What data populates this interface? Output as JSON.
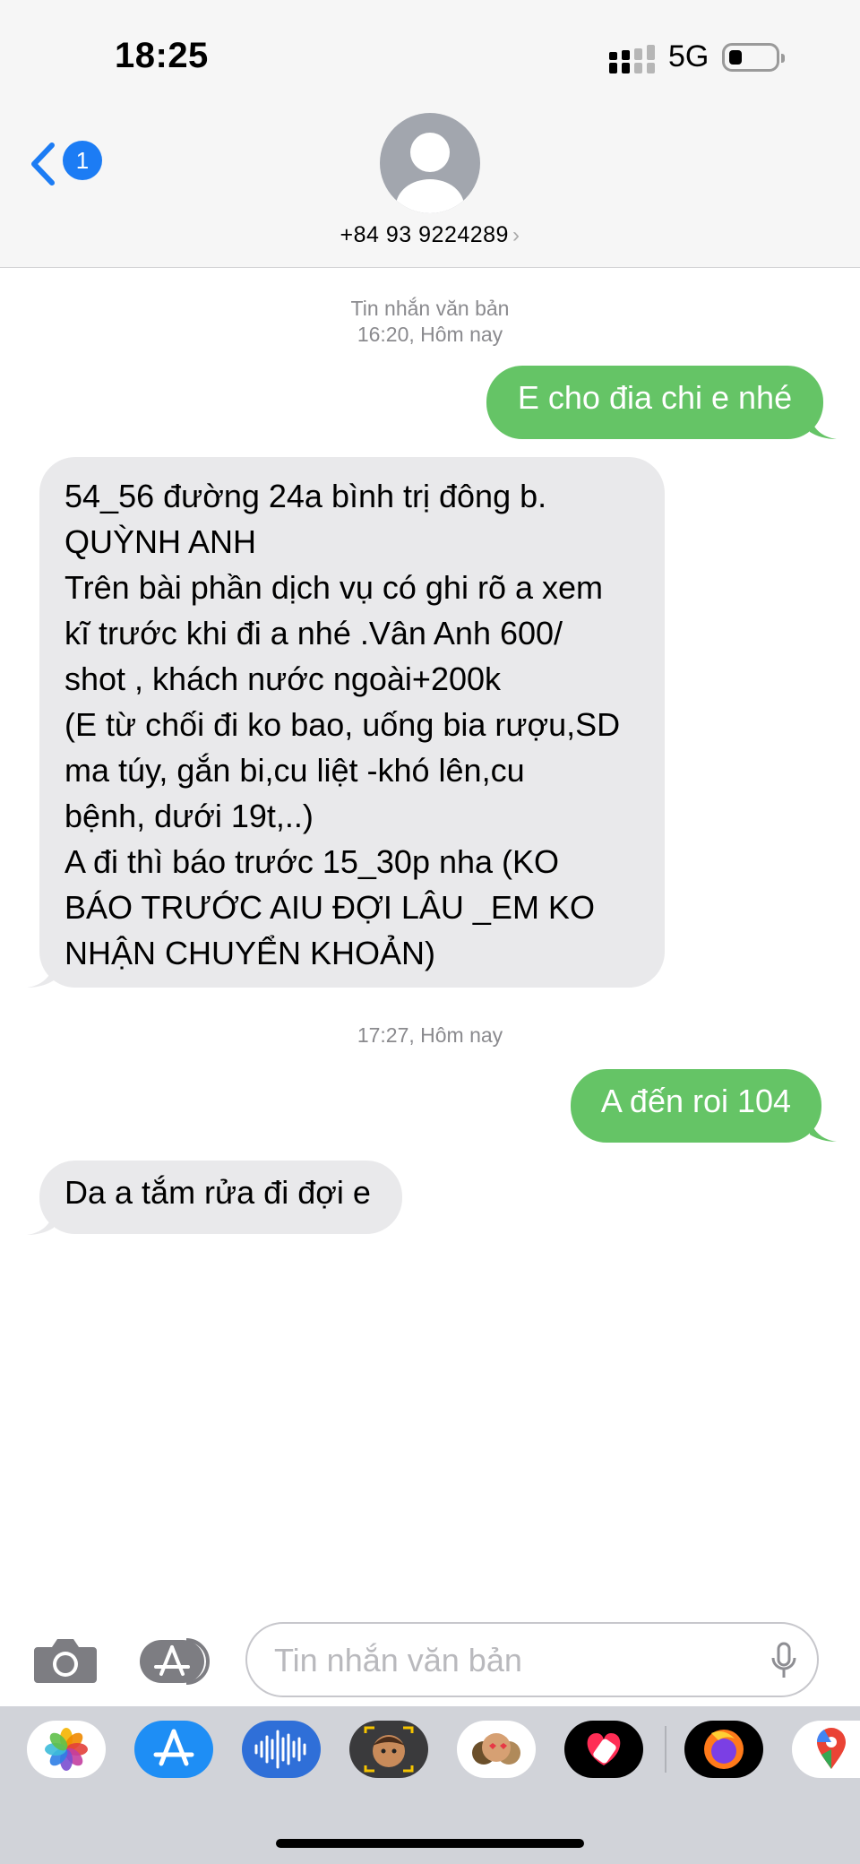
{
  "status_bar": {
    "time": "18:25",
    "network": "5G"
  },
  "header": {
    "back_badge": "1",
    "contact": "+84 93 9224289",
    "chevron": "›"
  },
  "thread": {
    "meta1": {
      "line1": "Tin nhắn văn bản",
      "line2": "16:20, Hôm nay"
    },
    "msg1": "E cho đia chi e nhé",
    "msg2_lines": [
      "54_56 đường 24a bình trị đông b.",
      "QUỲNH ANH",
      "Trên bài phần dịch vụ có ghi rõ a xem",
      "kĩ trước khi đi a nhé .Vân Anh 600/",
      "shot , khách nước ngoài+200k",
      "(E từ chối đi ko bao, uống bia rượu,SD",
      "ma túy, gắn bi,cu liệt -khó lên,cu",
      "bệnh, dưới 19t,..)",
      "A đi thì báo trước 15_30p nha (KO",
      "BÁO TRƯỚC AIU ĐỢI LÂU _EM KO",
      "NHẬN CHUYỂN KHOẢN)"
    ],
    "meta2": "17:27, Hôm nay",
    "msg3": "A đến roi 104",
    "msg4": "Da a tắm rửa đi đợi e"
  },
  "composer": {
    "placeholder": "Tin nhắn văn bản"
  },
  "drawer_apps": [
    "photos-app-icon",
    "app-store-icon",
    "audio-message-icon",
    "memoji-icon",
    "animoji-stickers-icon",
    "digital-touch-icon",
    "firefox-icon",
    "google-maps-icon"
  ],
  "colors": {
    "outgoing": "#65c466",
    "incoming": "#e9e9eb",
    "accent": "#1c7cf4",
    "header_bg": "#f6f6f6",
    "drawer_bg": "#d1d3d9"
  }
}
